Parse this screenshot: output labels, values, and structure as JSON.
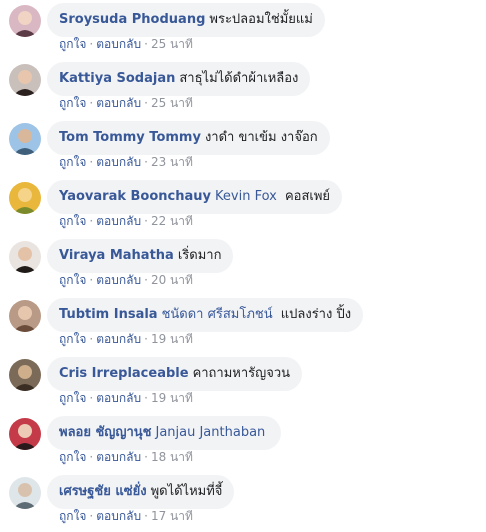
{
  "comments": [
    {
      "author": "Sroysuda Phoduang",
      "tag": "",
      "text": "พระปลอมใช่มั้ยแม่",
      "like": "ถูกใจ",
      "reply": "ตอบกลับ",
      "time": "25 นาที",
      "avatar": {
        "bg": "#d9b8c4",
        "fg": "#5a3b46",
        "face": "#f1d4c3"
      }
    },
    {
      "author": "Kattiya Sodajan",
      "tag": "",
      "text": "สาธุไม่ได้ดำผ้าเหลือง",
      "like": "ถูกใจ",
      "reply": "ตอบกลับ",
      "time": "25 นาที",
      "avatar": {
        "bg": "#c9c0bb",
        "fg": "#2b2220",
        "face": "#e7c6ad"
      }
    },
    {
      "author": "Tom Tommy Tommy",
      "tag": "",
      "text": "งาดำ ขาเข้ม งาจ๊อก",
      "like": "ถูกใจ",
      "reply": "ตอบกลับ",
      "time": "23 นาที",
      "avatar": {
        "bg": "#9dc3e6",
        "fg": "#3f5f7a",
        "face": "#d8b79b"
      }
    },
    {
      "author": "Yaovarak Boonchauy",
      "tag": "Kevin Fox",
      "text": "คอสเพย์",
      "like": "ถูกใจ",
      "reply": "ตอบกลับ",
      "time": "22 นาที",
      "avatar": {
        "bg": "#e8b73b",
        "fg": "#7b8b2c",
        "face": "#f5d48a"
      }
    },
    {
      "author": "Viraya Mahatha",
      "tag": "",
      "text": "เริ่ดมาก",
      "like": "ถูกใจ",
      "reply": "ตอบกลับ",
      "time": "20 นาที",
      "avatar": {
        "bg": "#e9e4e0",
        "fg": "#1f1a18",
        "face": "#e3c2a8"
      }
    },
    {
      "author": "Tubtim Insala",
      "tag": "ชนัดดา ศรีสมโภชน์",
      "text": "แปลงร่าง ปิ้ง",
      "like": "ถูกใจ",
      "reply": "ตอบกลับ",
      "time": "19 นาที",
      "avatar": {
        "bg": "#b89a86",
        "fg": "#6b4b3a",
        "face": "#e6c7ae"
      }
    },
    {
      "author": "Cris Irreplaceable",
      "tag": "",
      "text": "คาถามหารัญจวน",
      "like": "ถูกใจ",
      "reply": "ตอบกลับ",
      "time": "19 นาที",
      "avatar": {
        "bg": "#7b6a57",
        "fg": "#3a2e24",
        "face": "#cfae8c"
      }
    },
    {
      "author": "พลอย ชัญญานุช",
      "tag": "Janjau Janthaban",
      "text": "",
      "like": "ถูกใจ",
      "reply": "ตอบกลับ",
      "time": "18 นาที",
      "avatar": {
        "bg": "#c43a48",
        "fg": "#2a1a1c",
        "face": "#eccab6"
      }
    },
    {
      "author": "เศรษฐชัย แซ่ยั่ง",
      "tag": "",
      "text": "พูดได้ไหมที่จี้",
      "like": "ถูกใจ",
      "reply": "ตอบกลับ",
      "time": "17 นาที",
      "avatar": {
        "bg": "#dfe6ea",
        "fg": "#5c6b74",
        "face": "#d9c2ad"
      }
    }
  ]
}
